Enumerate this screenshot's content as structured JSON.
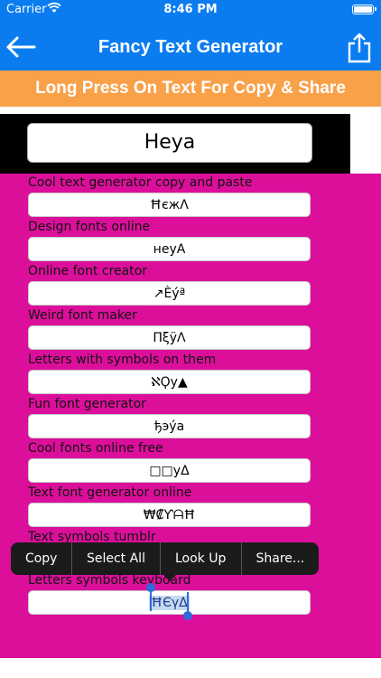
{
  "status": {
    "carrier": "Carrier",
    "time": "8:46 PM"
  },
  "navbar": {
    "title": "Fancy Text Generator"
  },
  "banner": {
    "text": "Long Press On Text For Copy & Share"
  },
  "input": {
    "value": "Heya"
  },
  "rows": [
    {
      "label": "Cool text generator copy and paste",
      "value": "ĦєжΛ"
    },
    {
      "label": "Design fonts online",
      "value": "ʜeyA"
    },
    {
      "label": "Online font creator",
      "value": "↗Èýª"
    },
    {
      "label": "Weird font maker",
      "value": "ΠξÿΛ"
    },
    {
      "label": "Letters with symbols on them",
      "value": "ℵϘy▲"
    },
    {
      "label": "Fun font generator",
      "value": "ђэýа"
    },
    {
      "label": "Cool fonts online free",
      "value": "□□yΔ"
    },
    {
      "label": "Text font generator online",
      "value": "₩₡ƳᗩĦ"
    },
    {
      "label": "Text symbols tumblr",
      "value": ""
    },
    {
      "label": "Letters symbols keyboard",
      "value": "ĦЄγΔ"
    }
  ],
  "context_menu": {
    "items": [
      "Copy",
      "Select All",
      "Look Up",
      "Share..."
    ]
  },
  "colors": {
    "nav": "#0a7cf0",
    "banner": "#f9a149",
    "background": "#dc0f9b"
  }
}
